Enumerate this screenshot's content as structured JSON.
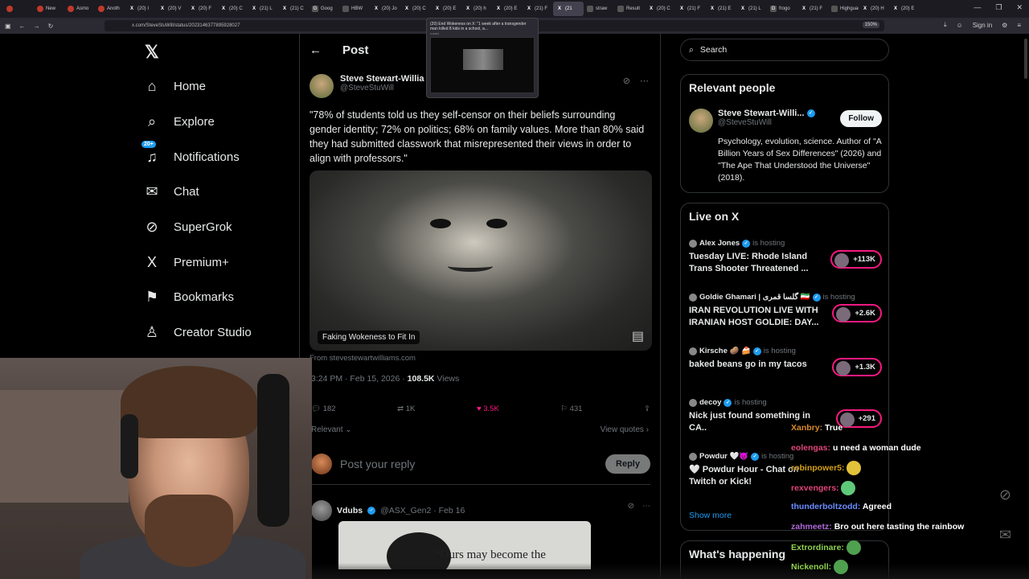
{
  "browser": {
    "tabs": [
      {
        "label": "",
        "icon": "firefox-view-icon",
        "fav": "r",
        "fav_glyph": ""
      },
      {
        "label": "New",
        "icon": "reddit-icon",
        "fav": "r",
        "fav_glyph": ""
      },
      {
        "label": "Asmo",
        "icon": "reddit-icon",
        "fav": "r",
        "fav_glyph": ""
      },
      {
        "label": "Anoth",
        "icon": "reddit-icon",
        "fav": "r",
        "fav_glyph": ""
      },
      {
        "label": "(20) I",
        "icon": "x-icon",
        "fav": "x",
        "fav_glyph": "X"
      },
      {
        "label": "(20) V",
        "icon": "x-icon",
        "fav": "x",
        "fav_glyph": "X"
      },
      {
        "label": "(20) F",
        "icon": "x-icon",
        "fav": "x",
        "fav_glyph": "X"
      },
      {
        "label": "(20) C",
        "icon": "x-icon",
        "fav": "x",
        "fav_glyph": "X"
      },
      {
        "label": "(21) L",
        "icon": "x-icon",
        "fav": "x",
        "fav_glyph": "X"
      },
      {
        "label": "(21) C",
        "icon": "x-icon",
        "fav": "x",
        "fav_glyph": "X"
      },
      {
        "label": "Goog",
        "icon": "google-icon",
        "fav": "",
        "fav_glyph": "G"
      },
      {
        "label": "HBW",
        "icon": "page-icon",
        "fav": "",
        "fav_glyph": ""
      },
      {
        "label": "(20) Jo",
        "icon": "x-icon",
        "fav": "x",
        "fav_glyph": "X"
      },
      {
        "label": "(20) C",
        "icon": "x-icon",
        "fav": "x",
        "fav_glyph": "X"
      },
      {
        "label": "(20) E",
        "icon": "x-icon",
        "fav": "x",
        "fav_glyph": "X"
      },
      {
        "label": "(20) h",
        "icon": "x-icon",
        "fav": "x",
        "fav_glyph": "X"
      },
      {
        "label": "(20) E",
        "icon": "x-icon",
        "fav": "x",
        "fav_glyph": "X"
      },
      {
        "label": "(21) F",
        "icon": "x-icon",
        "fav": "x",
        "fav_glyph": "X"
      },
      {
        "label": "(21",
        "icon": "x-icon",
        "fav": "x",
        "fav_glyph": "X",
        "active": true
      },
      {
        "label": "straw",
        "icon": "page-icon",
        "fav": "",
        "fav_glyph": ""
      },
      {
        "label": "Result",
        "icon": "page-icon",
        "fav": "",
        "fav_glyph": ""
      },
      {
        "label": "(20) C",
        "icon": "x-icon",
        "fav": "x",
        "fav_glyph": "X"
      },
      {
        "label": "(21) F",
        "icon": "x-icon",
        "fav": "x",
        "fav_glyph": "X"
      },
      {
        "label": "(21) E",
        "icon": "x-icon",
        "fav": "x",
        "fav_glyph": "X"
      },
      {
        "label": "(21) L",
        "icon": "x-icon",
        "fav": "x",
        "fav_glyph": "X"
      },
      {
        "label": "frogo",
        "icon": "google-icon",
        "fav": "",
        "fav_glyph": "G"
      },
      {
        "label": "(21) F",
        "icon": "x-icon",
        "fav": "x",
        "fav_glyph": "X"
      },
      {
        "label": "Highguar",
        "icon": "page-icon",
        "fav": "",
        "fav_glyph": ""
      },
      {
        "label": "(20) H",
        "icon": "x-icon",
        "fav": "x",
        "fav_glyph": "X"
      },
      {
        "label": "(20) E",
        "icon": "x-icon",
        "fav": "x",
        "fav_glyph": "X"
      }
    ],
    "url": "x.com/SteveStuWill/status/2023146377895928027",
    "zoom": "150%",
    "signin": "Sign in",
    "tooltip": {
      "title": "(20) End Wokeness on X: \"1 week after a transgender man killed 8 kids in a school, a...",
      "url": "x.com"
    }
  },
  "nav": {
    "items": [
      {
        "label": "Home",
        "icon": "home-icon",
        "glyph": "⌂"
      },
      {
        "label": "Explore",
        "icon": "search-icon",
        "glyph": "⌕"
      },
      {
        "label": "Notifications",
        "icon": "bell-icon",
        "glyph": "♫",
        "badge": "20+"
      },
      {
        "label": "Chat",
        "icon": "mail-icon",
        "glyph": "✉"
      },
      {
        "label": "SuperGrok",
        "icon": "grok-icon",
        "glyph": "⊘"
      },
      {
        "label": "Premium+",
        "icon": "x-logo-icon",
        "glyph": "X"
      },
      {
        "label": "Bookmarks",
        "icon": "bookmark-icon",
        "glyph": "⚑"
      },
      {
        "label": "Creator Studio",
        "icon": "creator-icon",
        "glyph": "♙"
      }
    ]
  },
  "post": {
    "header": "Post",
    "author_name": "Steve Stewart-Willia",
    "author_handle": "@SteveStuWill",
    "text": "\"78% of students told us they self-censor on their beliefs surrounding gender identity; 72% on politics; 68% on family values. More than 80% said they had submitted classwork that misrepresented their views in order to align with professors.\"",
    "media_caption": "Faking Wokeness to Fit In",
    "source": "From stevestewartwilliams.com",
    "time": "3:24 PM · Feb 15, 2026 · ",
    "views": "108.5K",
    "views_label": " Views",
    "replies": "182",
    "reposts": "1K",
    "likes": "3.5K",
    "bookmarks": "431",
    "relevant": "Relevant ⌄",
    "view_quotes": "View quotes ›",
    "reply_placeholder": "Post your reply",
    "reply_button": "Reply"
  },
  "reply": {
    "name": "Vdubs",
    "meta": "@ASX_Gen2 · Feb 16",
    "image_text": "“Ours may become the"
  },
  "right": {
    "search_placeholder": "Search",
    "relevant_people_title": "Relevant people",
    "person": {
      "name": "Steve Stewart-Willi...",
      "handle": "@SteveStuWill",
      "follow": "Follow",
      "bio": "Psychology, evolution, science. Author of \"A Billion Years of Sex Differences\" (2026) and \"The Ape That Understood the Universe\" (2018)."
    },
    "live_title": "Live on X",
    "live": [
      {
        "host": "Alex Jones",
        "is": "is hosting",
        "title": "Tuesday LIVE: Rhode Island Trans Shooter Threatened ...",
        "count": "+113K"
      },
      {
        "host": "Goldie Ghamari | گلسا قمری 🇮🇷",
        "is": "is hosting",
        "title": "IRAN REVOLUTION LIVE WITH IRANIAN HOST GOLDIE: DAY...",
        "count": "+2.6K"
      },
      {
        "host": "Kirsche 🥔 🍰",
        "is": "is hosting",
        "title": "baked beans go in my tacos",
        "count": "+1.3K"
      },
      {
        "host": "decoy",
        "is": "is hosting",
        "title": "Nick just found something in CA..",
        "count": "+291"
      },
      {
        "host": "Powdur 🤍😈",
        "is": "is hosting",
        "title": "🤍 Powdur Hour - Chat on Twitch or Kick!",
        "count": ""
      }
    ],
    "show_more": "Show more",
    "happening_title": "What's happening"
  },
  "chat": [
    {
      "user": "Xanbry:",
      "msg": "True",
      "color": "#d98b2a"
    },
    {
      "user": "eolengas:",
      "msg": "u need a woman dude",
      "color": "#e0457b"
    },
    {
      "user": "robinpower5:",
      "msg": "",
      "color": "#d4a017",
      "emote": "#e2c23a"
    },
    {
      "user": "rexvengers:",
      "msg": "",
      "color": "#e0457b",
      "emote": "#5fc97a"
    },
    {
      "user": "thunderboltzodd:",
      "msg": "Agreed",
      "color": "#6a8cff"
    },
    {
      "user": "zahmeetz:",
      "msg": "Bro out here tasting the rainbow",
      "color": "#b06ad8"
    },
    {
      "user": "Extrordinare:",
      "msg": "",
      "color": "#8fd14f",
      "emote": "#4fa04f"
    },
    {
      "user": "Nickenoll:",
      "msg": "",
      "color": "#8fd14f",
      "emote": "#4fa04f"
    }
  ],
  "colors": {
    "accent": "#1d9bf0",
    "like": "#f91880",
    "live_ring": "#f91880"
  }
}
